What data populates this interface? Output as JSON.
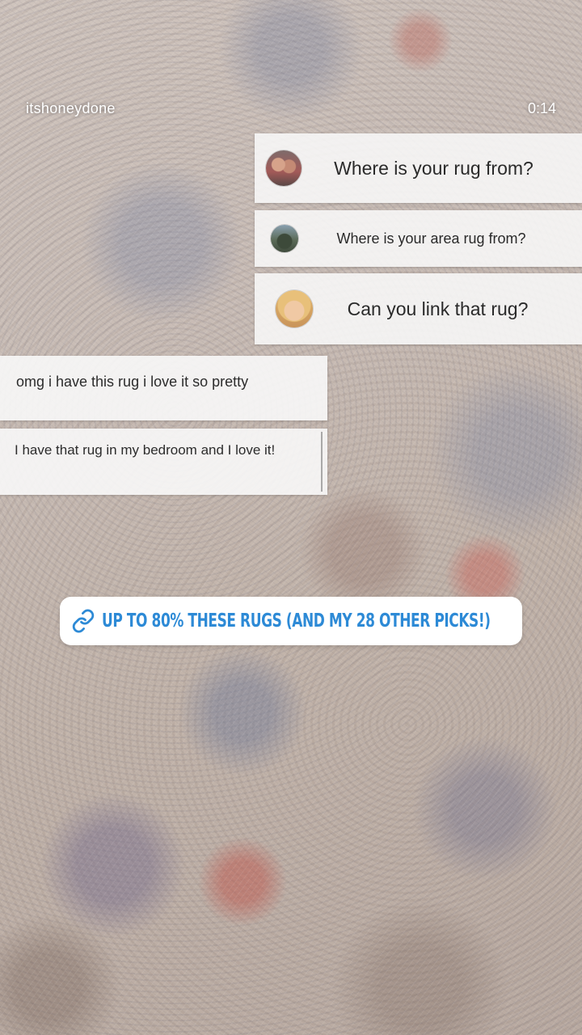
{
  "header": {
    "username": "itshoneydone",
    "timestamp": "0:14"
  },
  "questions": [
    {
      "text": "Where is your rug from?",
      "avatar": "avatar-couple"
    },
    {
      "text": "Where is your area rug from?",
      "avatar": "avatar-landscape"
    },
    {
      "text": "Can you link that rug?",
      "avatar": "avatar-blonde"
    }
  ],
  "comments": [
    {
      "text": "omg i have this rug i love it so pretty"
    },
    {
      "text": "I have that rug in my bedroom and I love it!"
    }
  ],
  "link_sticker": {
    "icon": "link-icon",
    "text": "UP TO 80% THESE RUGS (AND MY 28 OTHER PICKS!)",
    "color": "#2d8ad6"
  }
}
